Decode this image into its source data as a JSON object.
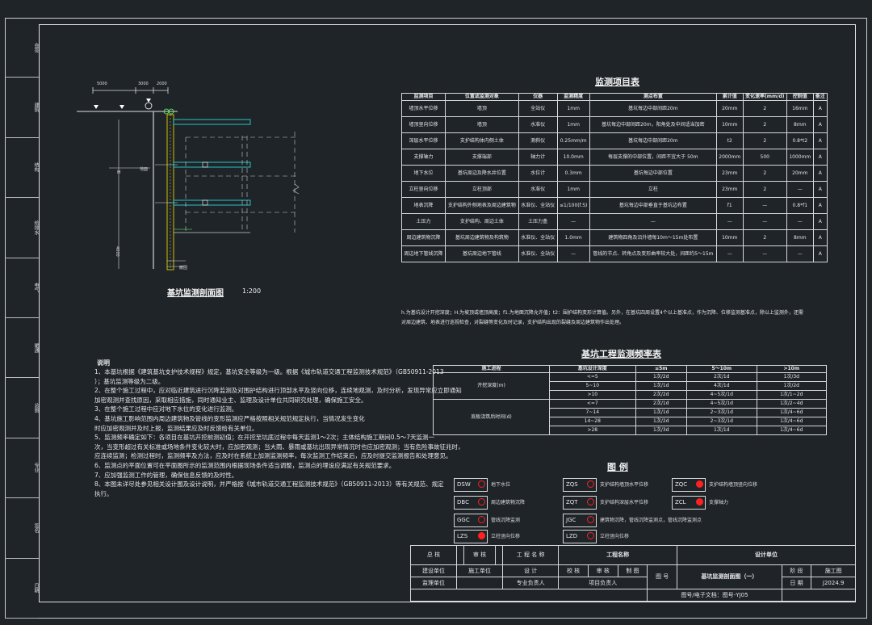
{
  "drawing": {
    "section_title": "基坑监测剖面图",
    "section_scale": "1:200",
    "top_dims": [
      "5000",
      "3000",
      "2000"
    ],
    "side_label_h": "H",
    "side_dim": "4000",
    "ground_label": "地面",
    "bottom_label": "嵌固"
  },
  "monitor_table": {
    "title": "监测项目表",
    "headers": [
      "监测项目",
      "位置或监测对象",
      "仪器",
      "监测精度",
      "测点布置",
      "累计值",
      "变化速率(mm/d)",
      "控制值",
      "备注"
    ],
    "rows": [
      [
        "墙顶水平位移",
        "墙顶",
        "全站仪",
        "1mm",
        "基坑每边中部间距20m",
        "20mm",
        "2",
        "16mm",
        "A"
      ],
      [
        "墙顶竖向位移",
        "墙顶",
        "水准仪",
        "1mm",
        "基坑每边中部间距20m，阳角处及中间适当加密",
        "10mm",
        "2",
        "8mm",
        "A"
      ],
      [
        "深层水平位移",
        "支护结构体内侧土体",
        "测斜仪",
        "0.25mm/m",
        "基坑每边中部间距20m",
        "t2",
        "2",
        "0.8*t2",
        "A"
      ],
      [
        "支撑轴力",
        "支撑端部",
        "轴力计",
        "10.0mm",
        "每层支撑的中部位置，间距不宜大于 50m",
        "2000mm",
        "500",
        "1000mm",
        "A"
      ],
      [
        "地下水位",
        "基坑周边及降水井位置",
        "水位计",
        "0.3mm",
        "基坑每边中部位置",
        "23mm",
        "2",
        "20mm",
        "A"
      ],
      [
        "立柱竖向位移",
        "立柱顶部",
        "水准仪",
        "1mm",
        "立柱",
        "23mm",
        "2",
        "—",
        "A"
      ],
      [
        "地表沉降",
        "支护结构外侧地表及周边建筑物",
        "水准仪、全站仪",
        "≤1/100(f.S)",
        "基坑每边中部垂直于基坑边布置",
        "f1",
        "—",
        "0.8*f1",
        "A"
      ],
      [
        "土压力",
        "支护结构、周边土体",
        "土压力盒",
        "—",
        "—",
        "—",
        "—",
        "—",
        "A"
      ],
      [
        "周边建筑物沉降",
        "基坑周边建筑物及构筑物",
        "水准仪、全站仪",
        "1.0mm",
        "建筑物四角及沿外墙每10m～15m处布置",
        "10mm",
        "2",
        "8mm",
        "A"
      ],
      [
        "周边地下管线沉降",
        "基坑周边地下管线",
        "水准仪、全站仪",
        "—",
        "管线的节点、转角点及变形曲率较大处，间距约5～15m",
        "—",
        "—",
        "—",
        "A"
      ]
    ],
    "footnote_1": "h.为基坑设计开挖深度；H.为坡顶或墙顶高度；f1.为地面沉降允许值；t2：围护结构变形计算值。另外，在基坑四周设置4个以上基准点，作为沉降、位移监测基准点，除以上监测外，还需",
    "footnote_2": "对周边建筑、地表进行巡视检查，对裂缝等变化及时记录，支护结构出现的裂缝及周边建筑物作出处理。"
  },
  "notes": {
    "heading": "说明",
    "lines": [
      "1、本基坑根据《建筑基坑支护技术规程》规定，基坑安全等级为一级。根据《城市轨道交通工程监测技术规范》（GB50911-2013",
      "）；基坑监测等级为二级。",
      "2、在整个施工过程中，应对临近建筑进行沉降监测及对围护结构进行顶部水平及竖向位移，连续地观测，及时分析，发现异常应立即通知",
      "加密观测并查找原因，采取相应措施，同时通知业主、监理及设计单位共同研究处理，确保施工安全。",
      "3、在整个施工过程中应对地下水位的变化进行监测。",
      "4、基坑施工影响范围内周边建筑物及管线的变形监测应严格按照相关规范规定执行，当情况发生变化",
      "时应加密观测并及时上报，监测结果应及时反馈给有关单位。",
      "5、监测频率确定如下：各项目在基坑开挖前测初值；在开挖至坑底过程中每天监测1～2次；主体结构施工期间0.5～7天监测一",
      "次，当变形超过有关标准或场地条件变化较大时，应加密观测；当大雨、暴雨或基坑出现异常情况时也应加密观测；当有危险事故征兆时，",
      "应连续监测；检测过程时，监测频率及方法，应及时在系统上加测监测频率，每次监测工作结束后，应及时提交监测报告和处理意见。",
      "6、监测点的平面位置可在平面图所示的监测范围内根据现场条件适当调整，监测点的埋设应满足有关规范要求。",
      "7、应加强监测工作的管理，确保信息反馈的及时性。",
      "8、本图未详尽处参见相关设计图及设计说明，并严格按《城市轨道交通工程监测技术规范》（GB50911-2013）等有关规范、规定",
      "执行。"
    ]
  },
  "freq_table": {
    "title": "基坑工程监测频率表",
    "headers": [
      "施工进程",
      "基坑设计深度",
      "≤5m",
      "5～10m",
      ">10m"
    ],
    "groups": [
      {
        "label": "开挖深度(m)",
        "rows": [
          [
            "<=5",
            "1次/2d",
            "2次/1d",
            "1次/3d"
          ],
          [
            "5~10",
            "1次/1d",
            "4次/1d",
            "1次/2d"
          ],
          [
            ">10",
            "2次/2d",
            "4~5次/1d",
            "1次/1~2d"
          ]
        ]
      },
      {
        "label": "底板浇筑后时间(d)",
        "rows": [
          [
            "<=7",
            "2次/1d",
            "4~5次/1d",
            "1次/2~4d"
          ],
          [
            "7~14",
            "1次/1d",
            "2~3次/1d",
            "1次/4~6d"
          ],
          [
            "14~28",
            "1次/2d",
            "2~3次/1d",
            "1次/4~6d"
          ],
          [
            ">28",
            "1次/3d",
            "1次/1d",
            "1次/4~6d"
          ]
        ]
      }
    ]
  },
  "legend": {
    "title": "图 例",
    "items": [
      {
        "code": "DSW",
        "desc": "地下水位"
      },
      {
        "code": "ZQS",
        "desc": "支护结构墙顶水平位移"
      },
      {
        "code": "ZQC",
        "desc": "支护结构墙顶竖向位移"
      },
      {
        "code": "DBC",
        "desc": "周边建筑物沉降"
      },
      {
        "code": "ZQT",
        "desc": "支护结构深层水平位移"
      },
      {
        "code": "ZCL",
        "desc": "支撑轴力"
      },
      {
        "code": "GGC",
        "desc": "管线沉降监测"
      },
      {
        "code": "JGC",
        "desc": "建筑物沉降，管线沉降监测点，管线沉降监测点"
      },
      {
        "code": "LZS",
        "desc": "立柱竖向位移"
      },
      {
        "code": "LZD",
        "desc": "立柱竖向位移"
      }
    ]
  },
  "title_block": {
    "project_name_label": "工程名称",
    "design_unit_label": "设计单位",
    "drawing_name": "基坑监测剖面图（一）",
    "c_approve": "总 核",
    "c_review": "审 核",
    "c_check": "校 核",
    "c_design": "设 计",
    "c_draw": "制 图",
    "c_project": "工 程 名 称",
    "c_build": "建设单位",
    "c_supervise": "监理单位",
    "c_constr": "施工单位",
    "c_stage": "阶 段",
    "c_stage_v": "施工图",
    "c_no": "图 号",
    "c_no_v": "J2024.9",
    "c_date": "日 期",
    "c_prof": "专业负责人",
    "c_leader": "项目负责人",
    "c_draw_no": "图号/电子文档：图号-YJ05"
  },
  "strip_cells": [
    "会签",
    "建筑",
    "结构",
    "给排水",
    "电气",
    "暖通",
    "总图",
    "专业",
    "签名",
    "日期"
  ]
}
